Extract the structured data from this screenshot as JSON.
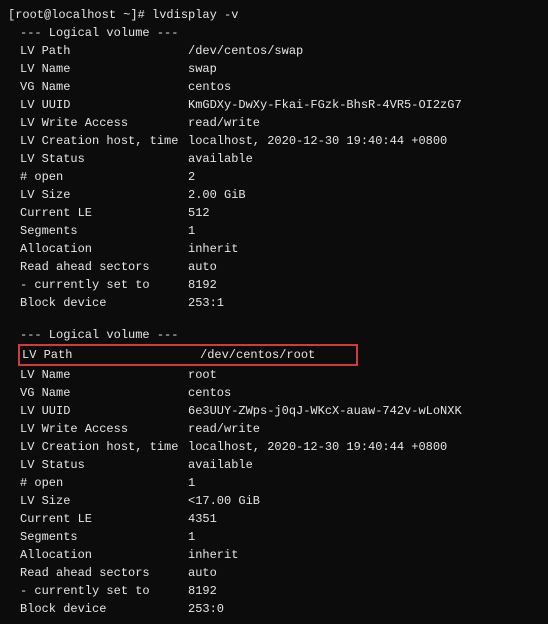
{
  "prompt": "[root@localhost ~]# lvdisplay -v",
  "divider": "--- Logical volume ---",
  "vol1": {
    "lv_path": {
      "k": "LV Path",
      "v": "/dev/centos/swap"
    },
    "lv_name": {
      "k": "LV Name",
      "v": "swap"
    },
    "vg_name": {
      "k": "VG Name",
      "v": "centos"
    },
    "lv_uuid": {
      "k": "LV UUID",
      "v": "KmGDXy-DwXy-Fkai-FGzk-BhsR-4VR5-OI2zG7"
    },
    "lv_write": {
      "k": "LV Write Access",
      "v": "read/write"
    },
    "lv_creation": {
      "k": "LV Creation host, time ",
      "v": "localhost, 2020-12-30 19:40:44 +0800"
    },
    "lv_status": {
      "k": "LV Status",
      "v": "available"
    },
    "open": {
      "k": "# open",
      "v": "2"
    },
    "lv_size": {
      "k": "LV Size",
      "v": "2.00 GiB"
    },
    "current_le": {
      "k": "Current LE",
      "v": "512"
    },
    "segments": {
      "k": "Segments",
      "v": "1"
    },
    "allocation": {
      "k": "Allocation",
      "v": "inherit"
    },
    "read_ahead": {
      "k": "Read ahead sectors",
      "v": "auto"
    },
    "currently": {
      "k": "- currently set to",
      "v": "8192"
    },
    "block_dev": {
      "k": "Block device",
      "v": "253:1"
    }
  },
  "vol2": {
    "lv_path": {
      "k": "LV Path",
      "v": "/dev/centos/root"
    },
    "lv_name": {
      "k": "LV Name",
      "v": "root"
    },
    "vg_name": {
      "k": "VG Name",
      "v": "centos"
    },
    "lv_uuid": {
      "k": "LV UUID",
      "v": "6e3UUY-ZWps-j0qJ-WKcX-auaw-742v-wLoNXK"
    },
    "lv_write": {
      "k": "LV Write Access",
      "v": "read/write"
    },
    "lv_creation": {
      "k": "LV Creation host, time ",
      "v": "localhost, 2020-12-30 19:40:44 +0800"
    },
    "lv_status": {
      "k": "LV Status",
      "v": "available"
    },
    "open": {
      "k": "# open",
      "v": "1"
    },
    "lv_size": {
      "k": "LV Size",
      "v": "<17.00 GiB"
    },
    "current_le": {
      "k": "Current LE",
      "v": "4351"
    },
    "segments": {
      "k": "Segments",
      "v": "1"
    },
    "allocation": {
      "k": "Allocation",
      "v": "inherit"
    },
    "read_ahead": {
      "k": "Read ahead sectors",
      "v": "auto"
    },
    "currently": {
      "k": "- currently set to",
      "v": "8192"
    },
    "block_dev": {
      "k": "Block device",
      "v": "253:0"
    }
  }
}
